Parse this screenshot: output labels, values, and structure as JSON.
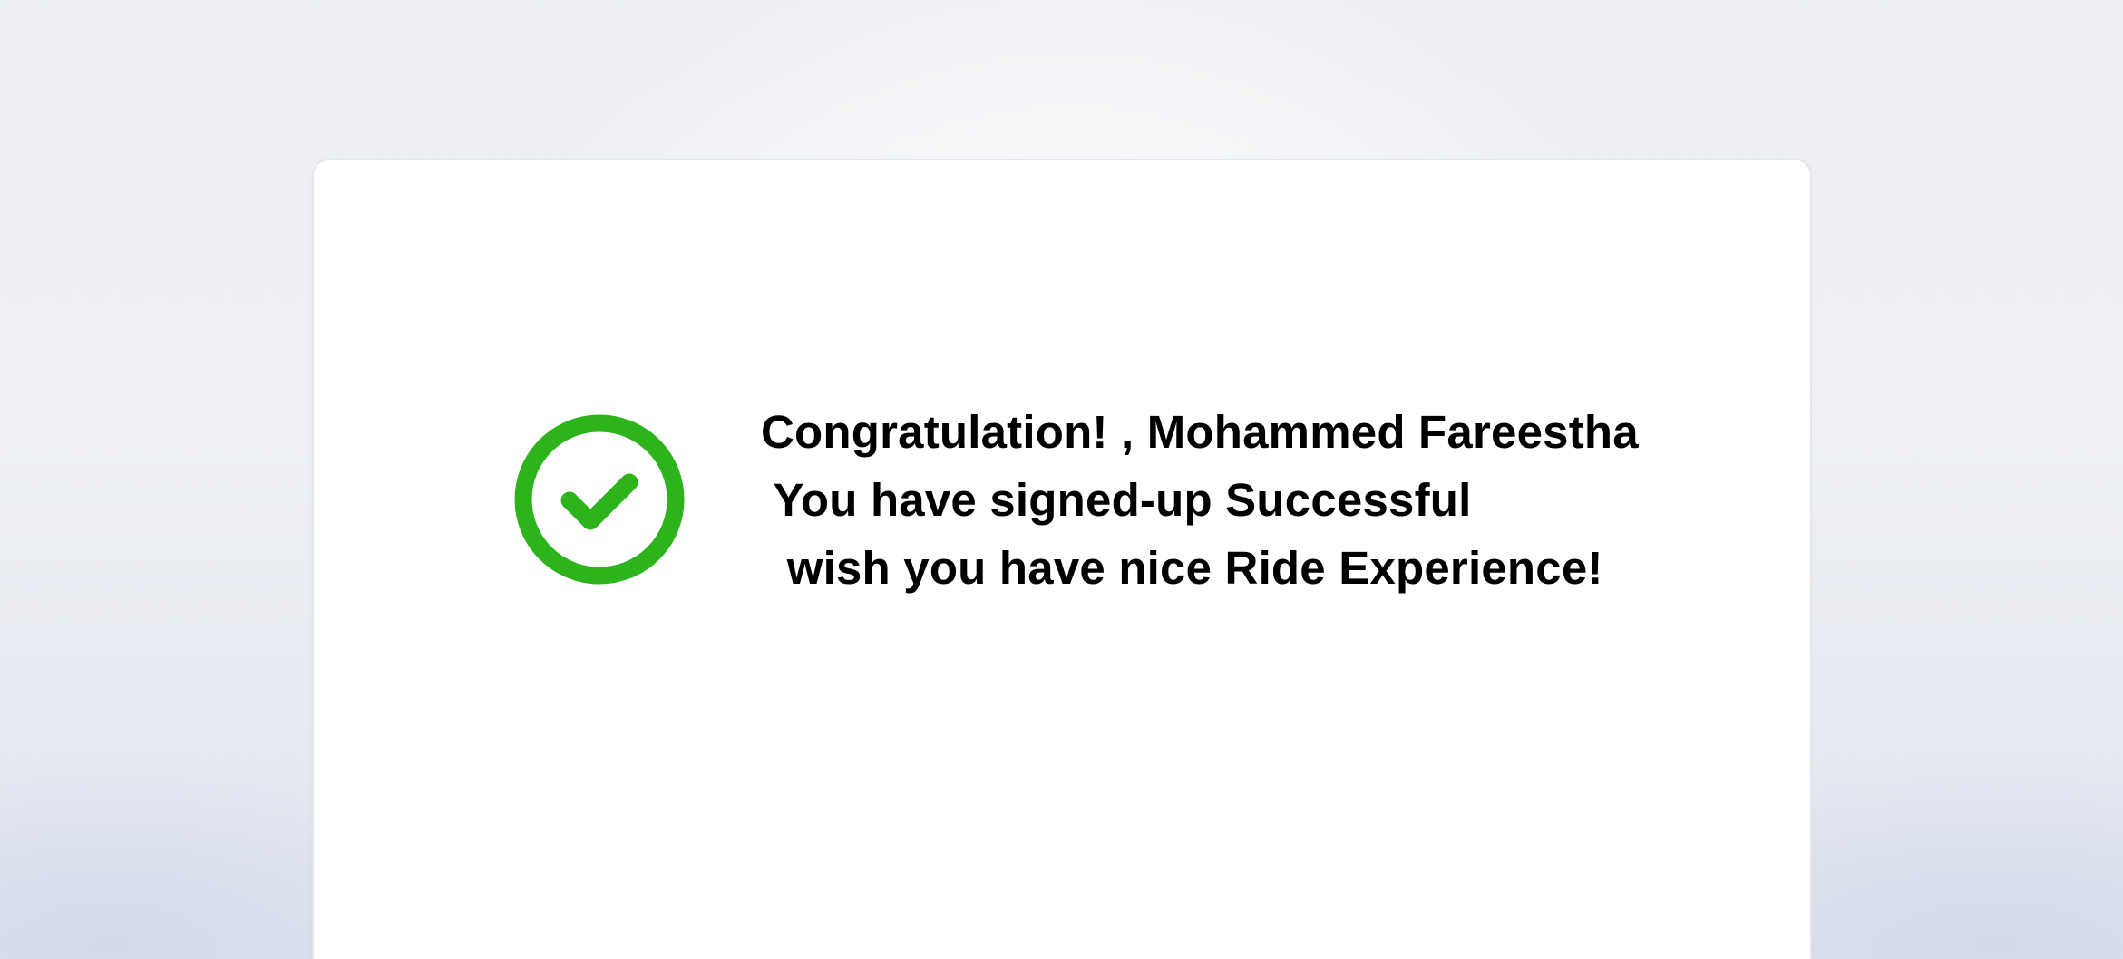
{
  "success": {
    "icon": "check-circle-icon",
    "accent_color": "#2db31b",
    "greeting": "Congratulation! , Mohammed Fareestha",
    "status": " You have signed-up Successful",
    "wish": "  wish you have nice Ride Experience!"
  }
}
